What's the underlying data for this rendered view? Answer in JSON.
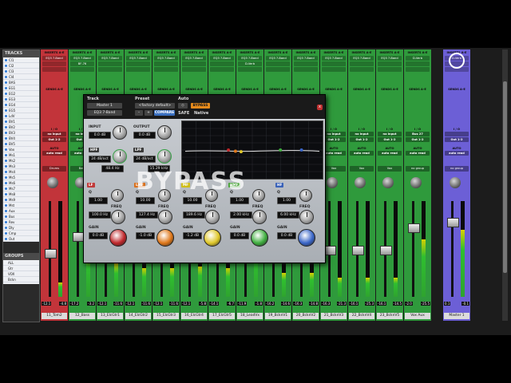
{
  "side_panel": {
    "tracks_title": "TRACKS",
    "groups_title": "GROUPS",
    "tracks": [
      "Cl1",
      "Cl2",
      "Cl3",
      "Cl4",
      "BAS",
      "EG1",
      "EG2",
      "EG3",
      "EG4",
      "EG5",
      "LdV",
      "BV1",
      "BV2",
      "BV3",
      "BV4",
      "BV5",
      "Vox",
      "Ms1",
      "Ms2",
      "Ms3",
      "Ms4",
      "Ms5",
      "Ms6",
      "Ms7",
      "Ms8",
      "Ms9",
      "Mst",
      "Aux",
      "Bus",
      "Rev",
      "Dly",
      "Cmp",
      "Out"
    ],
    "groups": [
      "ALL",
      "Gtr",
      "VOX",
      "Bckn"
    ]
  },
  "strip_labels": {
    "inserts": "INSERTS A-E",
    "sends": "SENDS A-E",
    "io": "I / O",
    "auto": "AUTO"
  },
  "strips": [
    {
      "name": "11_Tom2",
      "color": "#c2343a",
      "insert1": "EQ3 7-Band",
      "insert2": "",
      "input": "no input",
      "output": "Out 1-2",
      "auto": "auto read",
      "group": "Drums",
      "vol_left": "-12.1",
      "vol_right": "-4.8",
      "level": 0.15
    },
    {
      "name": "12_Bass",
      "color": "#2f9a3c",
      "insert1": "EQ3 7-Band",
      "insert2": "BF-76",
      "input": "no input",
      "output": "Out 1-2",
      "auto": "auto read",
      "group": "Bass",
      "vol_left": "-17.2",
      "vol_right": "-3.2",
      "level": 0.45
    },
    {
      "name": "13_ElcGtr1",
      "color": "#2f9a3c",
      "insert1": "EQ3 7-Band",
      "insert2": "",
      "input": "no input",
      "output": "Out 1-2",
      "auto": "auto read",
      "group": "Gtr",
      "vol_left": "-12.1",
      "vol_right": "-11.6",
      "level": 0.35
    },
    {
      "name": "14_ElcGtr2",
      "color": "#2f9a3c",
      "insert1": "EQ3 7-Band",
      "insert2": "",
      "input": "no input",
      "output": "Out 1-2",
      "auto": "auto read",
      "group": "Gtr",
      "vol_left": "-12.1",
      "vol_right": "-11.6",
      "level": 0.3
    },
    {
      "name": "15_ElcGtr3",
      "color": "#2f9a3c",
      "insert1": "EQ3 7-Band",
      "insert2": "",
      "input": "no input",
      "output": "Out 1-2",
      "auto": "auto read",
      "group": "Gtr",
      "vol_left": "-12.1",
      "vol_right": "-11.6",
      "level": 0.3
    },
    {
      "name": "16_ElcGtr4",
      "color": "#2f9a3c",
      "insert1": "EQ3 7-Band",
      "insert2": "",
      "input": "no input",
      "output": "Out 1-2",
      "auto": "auto read",
      "group": "Gtr",
      "vol_left": "-12.1",
      "vol_right": "-5.8",
      "level": 0.32
    },
    {
      "name": "17_ElcGtr5",
      "color": "#2f9a3c",
      "insert1": "EQ3 7-Band",
      "insert2": "",
      "input": "no input",
      "output": "Out 1-2",
      "auto": "auto read",
      "group": "Gtr",
      "vol_left": "-14.1",
      "vol_right": "-6.7",
      "level": 0.3
    },
    {
      "name": "18_LeadVx",
      "color": "#2f9a3c",
      "insert1": "EQ3 7-Band",
      "insert2": "D-Verb",
      "input": "no input",
      "output": "Out 1-2",
      "auto": "auto read",
      "group": "Vox",
      "vol_left": "-11.9",
      "vol_right": "-1.8",
      "level": 0.55
    },
    {
      "name": "19_BcknV1",
      "color": "#2f9a3c",
      "insert1": "EQ3 7-Band",
      "insert2": "",
      "input": "no input",
      "output": "Out 1-2",
      "auto": "auto read",
      "group": "Vox",
      "vol_left": "-16.2",
      "vol_right": "-14.6",
      "level": 0.25
    },
    {
      "name": "20_BcknV2",
      "color": "#2f9a3c",
      "insert1": "EQ3 7-Band",
      "insert2": "",
      "input": "no input",
      "output": "Out 1-2",
      "auto": "auto read",
      "group": "Vox",
      "vol_left": "-16.3",
      "vol_right": "-14.8",
      "level": 0.25
    },
    {
      "name": "21_BcknV3",
      "color": "#2f9a3c",
      "insert1": "EQ3 7-Band",
      "insert2": "",
      "input": "no input",
      "output": "Out 1-2",
      "auto": "auto read",
      "group": "Vox",
      "vol_left": "-16.3",
      "vol_right": "-21.3",
      "level": 0.2
    },
    {
      "name": "22_BcknV4",
      "color": "#2f9a3c",
      "insert1": "EQ3 7-Band",
      "insert2": "",
      "input": "no input",
      "output": "Out 1-2",
      "auto": "auto read",
      "group": "Vox",
      "vol_left": "-16.1",
      "vol_right": "-25.3",
      "level": 0.2
    },
    {
      "name": "23_BcknV5",
      "color": "#2f9a3c",
      "insert1": "EQ3 7-Band",
      "insert2": "",
      "input": "no input",
      "output": "Out 1-2",
      "auto": "auto read",
      "group": "Vox",
      "vol_left": "-16.1",
      "vol_right": "-14.5",
      "level": 0.2
    },
    {
      "name": "Vox Aux",
      "color": "#2f9a3c",
      "insert1": "D-Verb",
      "insert2": "",
      "input": "Bus 27",
      "output": "Out 1-2",
      "auto": "auto read",
      "group": "no group",
      "vol_left": "-2.0",
      "vol_right": "-25.5",
      "level": 0.6
    },
    {
      "name": "Master 1",
      "color": "#6c5fd6",
      "insert1": "D-Verb",
      "insert2": "",
      "input": "",
      "output": "Out 1-2",
      "auto": "auto read",
      "group": "no group",
      "vol_left": "0.1",
      "vol_right": "-0.1",
      "level": 0.7
    }
  ],
  "plugin": {
    "track_label": "Track",
    "preset_label": "Preset",
    "auto_label": "Auto",
    "track_name": "Master 1",
    "insert_name": "EQ3 7-Band",
    "preset_name": "<factory default>",
    "compare_label": "COMPARE",
    "bypass_label": "BYPASS",
    "safe_label": "SAFE",
    "native_label": "Native",
    "close_label": "x",
    "input_label": "INPUT",
    "output_label": "OUTPUT",
    "input_value": "0.0 dB",
    "output_value": "0.0 dB",
    "hpf_label": "HPF",
    "lpf_label": "LPF",
    "hpf_slope": "24 dB/oct",
    "lpf_slope": "24 dB/oct",
    "hpf_freq": "48.4 Hz",
    "lpf_freq": "15.29 kHz",
    "freq_label": "FREQ",
    "gain_label": "GAIN",
    "q_label": "Q",
    "bands": [
      {
        "name": "LF",
        "color": "#c03a3a",
        "q": "1.00",
        "freq": "100.0 Hz",
        "gain": "0.0 dB",
        "knob_color": "#c0282c"
      },
      {
        "name": "LMF",
        "color": "#d9701c",
        "q": "10.00",
        "freq": "127.4 Hz",
        "gain": "-1.0 dB",
        "knob_color": "#e0781a"
      },
      {
        "name": "MF",
        "color": "#cfbe1a",
        "q": "10.00",
        "freq": "189.6 Hz",
        "gain": "-1.2 dB",
        "knob_color": "#e0c82a"
      },
      {
        "name": "HMF",
        "color": "#49a339",
        "q": "1.00",
        "freq": "2.00 kHz",
        "gain": "0.0 dB",
        "knob_color": "#3fae3f"
      },
      {
        "name": "HF",
        "color": "#3a62b8",
        "q": "1.00",
        "freq": "6.00 kHz",
        "gain": "0.0 dB",
        "knob_color": "#3a66c8"
      }
    ],
    "graph_labels": [
      "+18",
      "+12",
      "+6",
      "0",
      "-6",
      "-12",
      "-18"
    ],
    "band_points_x": [
      0.33,
      0.38,
      0.42,
      0.7,
      0.85
    ],
    "band_points_y": [
      0.5,
      0.52,
      0.53,
      0.5,
      0.5
    ],
    "point_colors": [
      "#c0282c",
      "#e0781a",
      "#e0c82a",
      "#3fae3f",
      "#3a66c8"
    ]
  },
  "watermark": "BYPASS"
}
